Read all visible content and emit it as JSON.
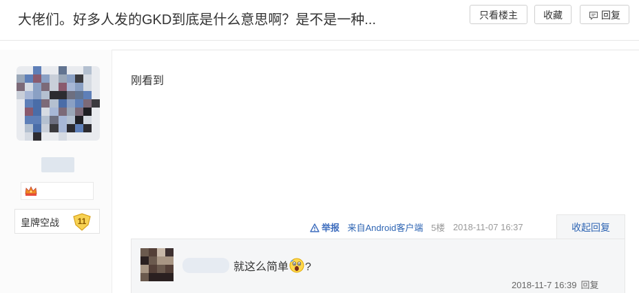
{
  "header": {
    "thread_title": "大佬们。好多人发的GKD到底是什么意思啊？是不是一种...",
    "only_op_label": "只看楼主",
    "favorite_label": "收藏",
    "reply_label": "回复"
  },
  "author": {
    "honor_title": "皇牌空战",
    "level": "11"
  },
  "post": {
    "content": "刚看到",
    "report_label": "举报",
    "client": "来自Android客户端",
    "floor": "5楼",
    "time": "2018-11-07 16:37",
    "collapse_label": "收起回复"
  },
  "subreply": {
    "text_before": "就这么简单",
    "text_after": "?",
    "time": "2018-11-7 16:39",
    "reply_label": "回复"
  },
  "colors": {
    "link": "#2d64b3",
    "report": "#3c6cbd",
    "honor_badge": "#f5c542",
    "border": "#e6e6e6",
    "subreply_bg": "#f5f6f7"
  },
  "icons": {
    "reply_button": "comment-bubble-icon",
    "report": "warning-triangle-icon",
    "badge": "crown-badge-icon",
    "level": "shield-level-icon",
    "emoji": "scared-face-emoji-icon"
  }
}
